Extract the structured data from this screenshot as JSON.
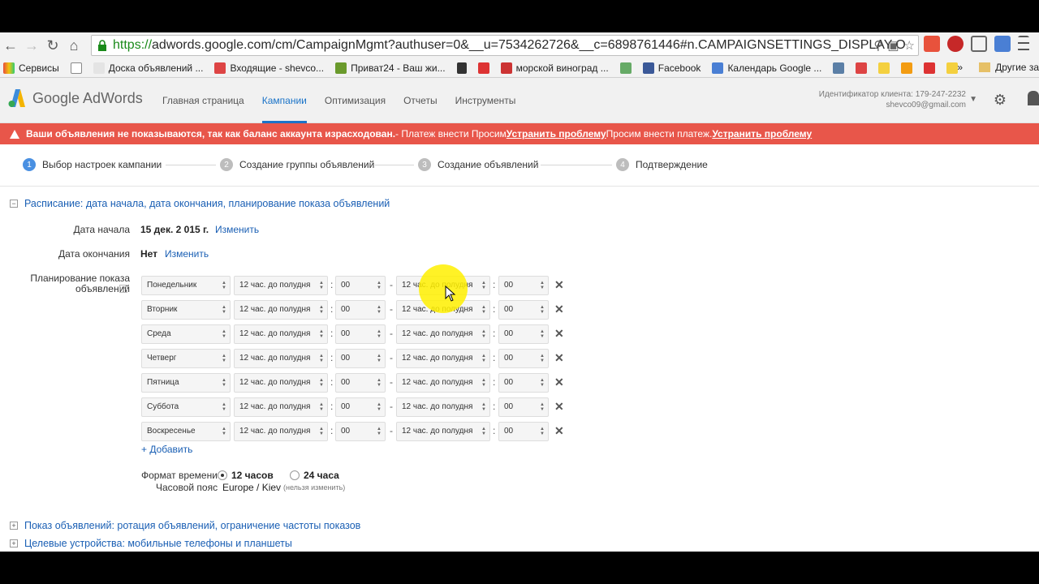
{
  "browser": {
    "url_https": "https://",
    "url_rest": "adwords.google.com/cm/CampaignMgmt?authuser=0&__u=7534262726&__c=6898761446#n.CAMPAIGNSETTINGS_DISPLAY-O",
    "bookmarks": [
      "Сервисы",
      "Доска объявлений ...",
      "Входящие - shevco...",
      "Приват24 - Ваш жи...",
      "морской виноград ...",
      "Facebook",
      "Календарь Google ..."
    ],
    "other_bookmarks": "Другие за",
    "overflow": "»"
  },
  "header": {
    "logo": "Google AdWords",
    "nav": [
      "Главная страница",
      "Кампании",
      "Оптимизация",
      "Отчеты",
      "Инструменты"
    ],
    "client_id": "Идентификатор клиента: 179-247-2232",
    "email": "shevco09@gmail.com"
  },
  "alert": {
    "bold": "Ваши объявления не показываются, так как баланс аккаунта израсходован.",
    "text1": "- Платеж внести Просим ",
    "fix1": "Устранить проблему",
    "text2": "Просим внести платеж. ",
    "fix2": "Устранить проблему"
  },
  "steps": [
    {
      "num": "1",
      "label": "Выбор настроек кампании"
    },
    {
      "num": "2",
      "label": "Создание группы объявлений"
    },
    {
      "num": "3",
      "label": "Создание объявлений"
    },
    {
      "num": "4",
      "label": "Подтверждение"
    }
  ],
  "schedule": {
    "section_title": "Расписание: дата начала, дата окончания, планирование показа объявлений",
    "start_label": "Дата начала",
    "start_value": "15 дек. 2 015 г.",
    "end_label": "Дата окончания",
    "end_value": "Нет",
    "change": "Изменить",
    "planning_label1": "Планирование показа",
    "planning_label2": "объявлений",
    "help": "?",
    "days": [
      "Понедельник",
      "Вторник",
      "Среда",
      "Четверг",
      "Пятница",
      "Суббота",
      "Воскресенье"
    ],
    "hour": "12 час. до полудня",
    "minute": "00",
    "dash": "-",
    "colon": ":",
    "add": "+ Добавить",
    "format_label": "Формат времени",
    "format_12": "12 часов",
    "format_24": "24 часа",
    "tz_label": "Часовой пояс",
    "tz_value": "Europe / Kiev",
    "tz_note": "(нельзя изменить)"
  },
  "sections": [
    "Показ объявлений: ротация объявлений, ограничение частоты показов",
    "Целевые устройства: мобильные телефоны и планшеты"
  ]
}
